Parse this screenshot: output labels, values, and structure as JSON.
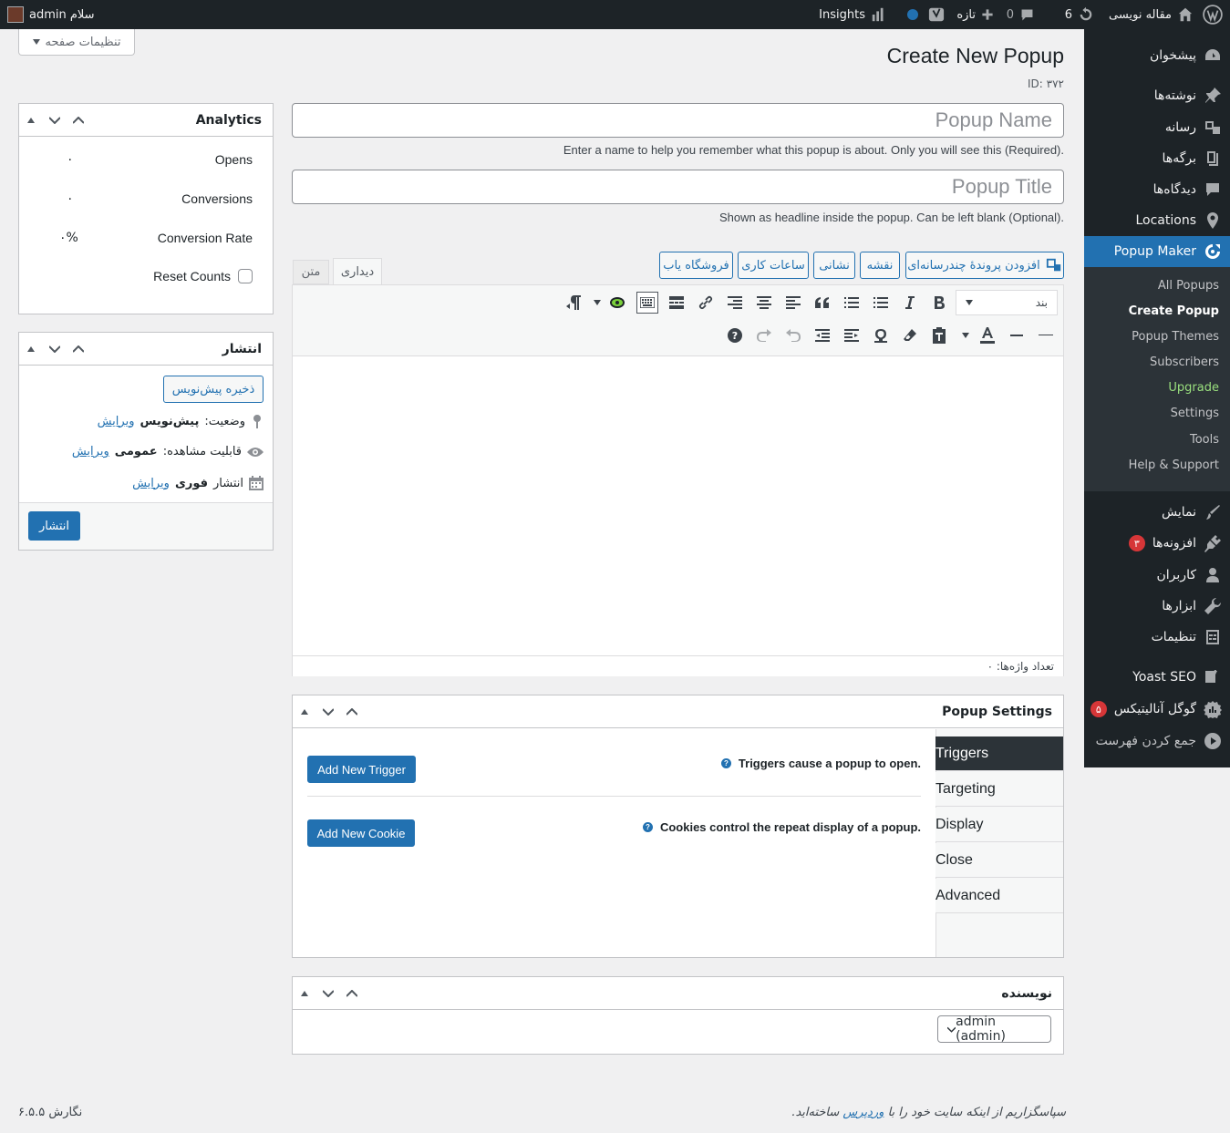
{
  "adminbar": {
    "site_name": "مقاله نویسی",
    "updates_count": "6",
    "comments_count": "0",
    "new_label": "تازه",
    "insights_label": "Insights",
    "greeting": "سلام admin"
  },
  "sidebar": {
    "items": [
      {
        "label": "پیشخوان",
        "icon": "dashboard-icon"
      },
      {
        "label": "نوشته‌ها",
        "icon": "pin-icon"
      },
      {
        "label": "رسانه",
        "icon": "media-icon"
      },
      {
        "label": "برگه‌ها",
        "icon": "pages-icon"
      },
      {
        "label": "دیدگاه‌ها",
        "icon": "comments-icon"
      },
      {
        "label": "Locations",
        "icon": "location-icon"
      },
      {
        "label": "Popup Maker",
        "icon": "popup-maker-icon"
      },
      {
        "label": "نمایش",
        "icon": "appearance-icon"
      },
      {
        "label": "افزونه‌ها",
        "icon": "plugins-icon",
        "badge": "۳"
      },
      {
        "label": "کاربران",
        "icon": "users-icon"
      },
      {
        "label": "ابزارها",
        "icon": "tools-icon"
      },
      {
        "label": "تنظیمات",
        "icon": "settings-icon"
      },
      {
        "label": "Yoast SEO",
        "icon": "yoast-icon"
      },
      {
        "label": "گوگل آنالیتیکس",
        "icon": "analytics-icon",
        "badge": "۵"
      },
      {
        "label": "جمع کردن فهرست",
        "icon": "collapse-icon"
      }
    ],
    "submenu": [
      "All Popups",
      "Create Popup",
      "Popup Themes",
      "Subscribers",
      "Upgrade",
      "Settings",
      "Tools",
      "Help & Support"
    ]
  },
  "screen_options": "تنظیمات صفحه",
  "page": {
    "title": "Create New Popup",
    "id_label": "ID: ۳۷۲",
    "name_placeholder": "Popup Name",
    "name_help": "Enter a name to help you remember what this popup is about. Only you will see this (Required).",
    "title_placeholder": "Popup Title",
    "title_help": "Shown as headline inside the popup. Can be left blank (Optional)."
  },
  "editor": {
    "media_buttons": [
      "افزودن پروندهٔ چندرسانه‌ای",
      "نقشه",
      "نشانی",
      "ساعات کاری",
      "فروشگاه یاب"
    ],
    "tab_visual": "دیداری",
    "tab_text": "متن",
    "format_select": "بند",
    "word_count": "تعداد واژه‌ها: ۰"
  },
  "popup_settings": {
    "title": "Popup Settings",
    "tabs": [
      "Triggers",
      "Targeting",
      "Display",
      "Close",
      "Advanced"
    ],
    "triggers_text": "Triggers cause a popup to open.",
    "add_trigger": "Add New Trigger",
    "cookies_text": "Cookies control the repeat display of a popup.",
    "add_cookie": "Add New Cookie",
    "help_glyph": "?"
  },
  "author_box": {
    "title": "نویسنده",
    "selected": "admin (admin)"
  },
  "analytics": {
    "title": "Analytics",
    "rows": [
      {
        "label": "Opens",
        "value": "۰"
      },
      {
        "label": "Conversions",
        "value": "۰"
      },
      {
        "label": "Conversion Rate",
        "value": "۰%"
      }
    ],
    "reset_label": "Reset Counts"
  },
  "publish": {
    "title": "انتشار",
    "save_draft": "ذخیره پیش‌نویس",
    "status_label": "وضعیت:",
    "status_value": "پیش‌نویس",
    "visibility_label": "قابلیت مشاهده:",
    "visibility_value": "عمومی",
    "schedule_label": "انتشار",
    "schedule_value": "فوری",
    "edit_link": "ویرایش",
    "publish_button": "انتشار"
  },
  "footer": {
    "thanks_prefix": "سپاسگزاریم از اینکه سایت خود را با",
    "thanks_link": "وردپرس",
    "thanks_suffix": "ساخته‌اید.",
    "version": "نگارش ۶.۵.۵"
  },
  "colors": {
    "admin_bar": "#1d2327",
    "accent": "#2271b1",
    "badge": "#d63638",
    "upgrade": "#9ae07e"
  }
}
